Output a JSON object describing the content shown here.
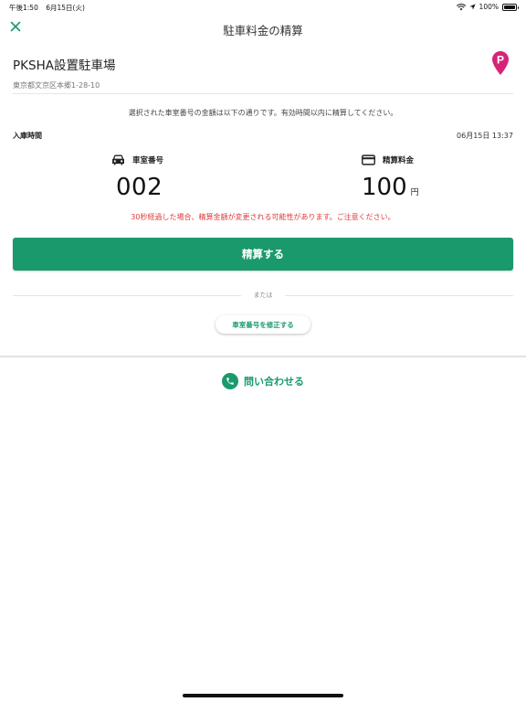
{
  "status_bar": {
    "time": "午後1:50",
    "date": "6月15日(火)",
    "battery": "100%"
  },
  "nav": {
    "title": "駐車料金の精算"
  },
  "lot": {
    "name": "PKSHA設置駐車場",
    "address": "東京都文京区本郷1-28-10"
  },
  "notice": "選択された車室番号の金額は以下の通りです。有効時間以内に精算してください。",
  "entry": {
    "label": "入庫時間",
    "value": "06月15日 13:37"
  },
  "room": {
    "label": "車室番号",
    "value": "002"
  },
  "fee": {
    "label": "精算料金",
    "amount": "100",
    "unit": "円"
  },
  "warning": "30秒経過した場合、精算金額が変更される可能性があります。ご注意ください。",
  "actions": {
    "pay_label": "精算する",
    "or_label": "または",
    "edit_label": "車室番号を修正する"
  },
  "contact": {
    "label": "問い合わせる"
  },
  "colors": {
    "accent": "#1a9a6c",
    "warning": "#e0393c",
    "pin": "#d6247a"
  },
  "icons": {
    "close": "close-icon",
    "pin": "parking-pin-icon",
    "car": "car-icon",
    "card": "credit-card-icon",
    "phone": "phone-icon"
  }
}
